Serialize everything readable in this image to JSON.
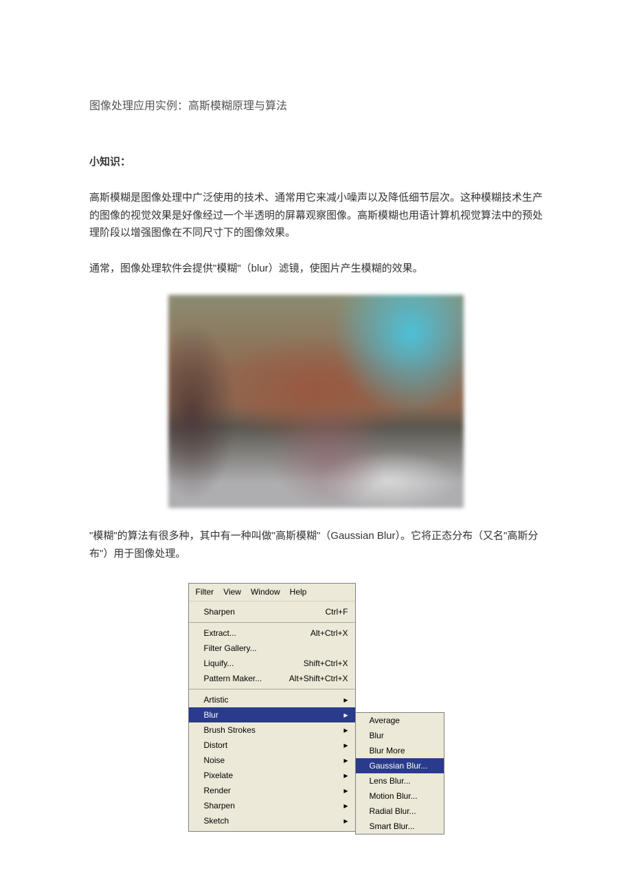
{
  "title": "图像处理应用实例：高斯模糊原理与算法",
  "heading_knowledge": "小知识：",
  "para1": "高斯模糊是图像处理中广泛使用的技术、通常用它来减小噪声以及降低细节层次。这种模糊技术生产的图像的视觉效果是好像经过一个半透明的屏幕观察图像。高斯模糊也用语计算机视觉算法中的预处理阶段以增强图像在不同尺寸下的图像效果。",
  "para2": "通常，图像处理软件会提供\"模糊\"（blur）滤镜，使图片产生模糊的效果。",
  "para3": "\"模糊\"的算法有很多种，其中有一种叫做\"高斯模糊\"（Gaussian Blur）。它将正态分布（又名\"高斯分布\"）用于图像处理。",
  "menu": {
    "menubar": [
      "Filter",
      "View",
      "Window",
      "Help"
    ],
    "sections": [
      [
        {
          "label": "Sharpen",
          "shortcut": "Ctrl+F"
        }
      ],
      [
        {
          "label": "Extract...",
          "shortcut": "Alt+Ctrl+X"
        },
        {
          "label": "Filter Gallery...",
          "shortcut": ""
        },
        {
          "label": "Liquify...",
          "shortcut": "Shift+Ctrl+X"
        },
        {
          "label": "Pattern Maker...",
          "shortcut": "Alt+Shift+Ctrl+X"
        }
      ],
      [
        {
          "label": "Artistic",
          "submenu": true
        },
        {
          "label": "Blur",
          "submenu": true,
          "selected": true
        },
        {
          "label": "Brush Strokes",
          "submenu": true
        },
        {
          "label": "Distort",
          "submenu": true
        },
        {
          "label": "Noise",
          "submenu": true
        },
        {
          "label": "Pixelate",
          "submenu": true
        },
        {
          "label": "Render",
          "submenu": true
        },
        {
          "label": "Sharpen",
          "submenu": true
        },
        {
          "label": "Sketch",
          "submenu": true
        }
      ]
    ],
    "submenu": [
      {
        "label": "Average"
      },
      {
        "label": "Blur"
      },
      {
        "label": "Blur More"
      },
      {
        "label": "Gaussian Blur...",
        "selected": true
      },
      {
        "label": "Lens Blur..."
      },
      {
        "label": "Motion Blur..."
      },
      {
        "label": "Radial Blur..."
      },
      {
        "label": "Smart Blur..."
      }
    ]
  }
}
